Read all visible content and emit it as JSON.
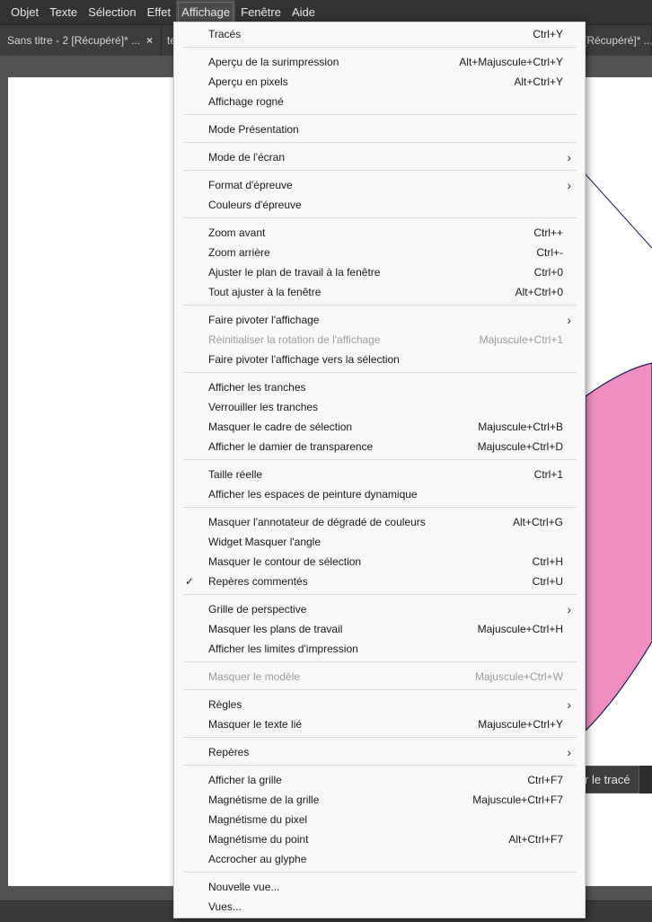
{
  "menubar": {
    "items": [
      {
        "label": "Objet"
      },
      {
        "label": "Texte"
      },
      {
        "label": "Sélection"
      },
      {
        "label": "Effet"
      },
      {
        "label": "Affichage"
      },
      {
        "label": "Fenêtre"
      },
      {
        "label": "Aide"
      }
    ]
  },
  "tabs": {
    "tab1_label": "Sans titre - 2 [Récupéré]* ...",
    "tab1_close": "×",
    "tab2_label": "te",
    "tab3_label": "[Récupéré]* ..."
  },
  "canvas": {
    "button_label": "r le tracé",
    "shape_fill": "#f08fbf",
    "shape_stroke": "#1b1b5a"
  },
  "menu": {
    "items": [
      {
        "label": "Tracés",
        "shortcut": "Ctrl+Y"
      },
      {
        "label": "Aperçu de la surimpression",
        "shortcut": "Alt+Majuscule+Ctrl+Y"
      },
      {
        "label": "Aperçu en pixels",
        "shortcut": "Alt+Ctrl+Y"
      },
      {
        "label": "Affichage rogné",
        "shortcut": ""
      },
      {
        "label": "Mode Présentation",
        "shortcut": ""
      },
      {
        "label": "Mode de l'écran",
        "shortcut": "",
        "submenu": true
      },
      {
        "label": "Format d'épreuve",
        "shortcut": "",
        "submenu": true
      },
      {
        "label": "Couleurs d'épreuve",
        "shortcut": ""
      },
      {
        "label": "Zoom avant",
        "shortcut": "Ctrl++"
      },
      {
        "label": "Zoom arrière",
        "shortcut": "Ctrl+-"
      },
      {
        "label": "Ajuster le plan de travail à la fenêtre",
        "shortcut": "Ctrl+0"
      },
      {
        "label": "Tout ajuster à la fenêtre",
        "shortcut": "Alt+Ctrl+0"
      },
      {
        "label": "Faire pivoter l'affichage",
        "shortcut": "",
        "submenu": true
      },
      {
        "label": "Réinitialiser la rotation de l'affichage",
        "shortcut": "Majuscule+Ctrl+1",
        "disabled": true
      },
      {
        "label": "Faire pivoter l'affichage vers la sélection",
        "shortcut": ""
      },
      {
        "label": "Afficher les tranches",
        "shortcut": ""
      },
      {
        "label": "Verrouiller les tranches",
        "shortcut": ""
      },
      {
        "label": "Masquer le cadre de sélection",
        "shortcut": "Majuscule+Ctrl+B"
      },
      {
        "label": "Afficher le damier de transparence",
        "shortcut": "Majuscule+Ctrl+D"
      },
      {
        "label": "Taille réelle",
        "shortcut": "Ctrl+1"
      },
      {
        "label": "Afficher les espaces de peinture dynamique",
        "shortcut": ""
      },
      {
        "label": "Masquer l'annotateur de dégradé de couleurs",
        "shortcut": "Alt+Ctrl+G"
      },
      {
        "label": "Widget Masquer l'angle",
        "shortcut": ""
      },
      {
        "label": "Masquer le contour de sélection",
        "shortcut": "Ctrl+H"
      },
      {
        "label": "Repères commentés",
        "shortcut": "Ctrl+U",
        "checked": true
      },
      {
        "label": "Grille de perspective",
        "shortcut": "",
        "submenu": true
      },
      {
        "label": "Masquer les plans de travail",
        "shortcut": "Majuscule+Ctrl+H"
      },
      {
        "label": "Afficher les limites d'impression",
        "shortcut": ""
      },
      {
        "label": "Masquer le modèle",
        "shortcut": "Majuscule+Ctrl+W",
        "disabled": true
      },
      {
        "label": "Règles",
        "shortcut": "",
        "submenu": true
      },
      {
        "label": "Masquer le texte lié",
        "shortcut": "Majuscule+Ctrl+Y"
      },
      {
        "label": "Repères",
        "shortcut": "",
        "submenu": true
      },
      {
        "label": "Afficher la grille",
        "shortcut": "Ctrl+F7"
      },
      {
        "label": "Magnétisme de la grille",
        "shortcut": "Majuscule+Ctrl+F7"
      },
      {
        "label": "Magnétisme du pixel",
        "shortcut": ""
      },
      {
        "label": "Magnétisme du point",
        "shortcut": "Alt+Ctrl+F7"
      },
      {
        "label": "Accrocher au glyphe",
        "shortcut": ""
      },
      {
        "label": "Nouvelle vue...",
        "shortcut": ""
      },
      {
        "label": "Vues...",
        "shortcut": ""
      }
    ],
    "submenu_glyph": "›",
    "check_glyph": "✓"
  }
}
